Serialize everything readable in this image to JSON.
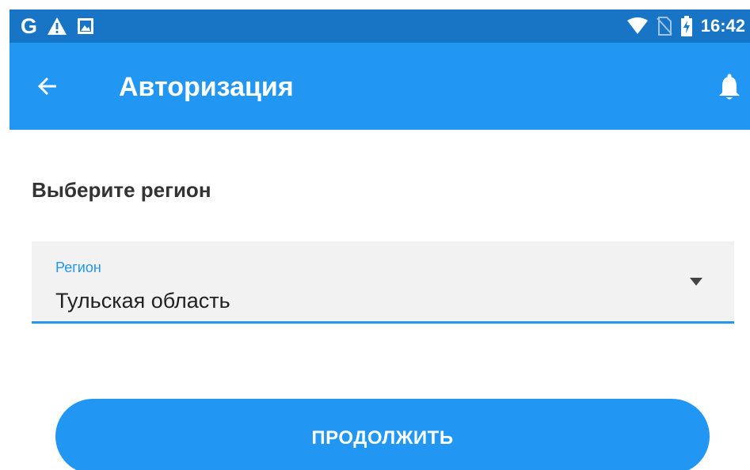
{
  "status_bar": {
    "time": "16:42",
    "left_icons": [
      "google-icon",
      "warning-icon",
      "image-notification-icon"
    ],
    "right_icons": [
      "wifi-icon",
      "no-sim-icon",
      "battery-charging-icon"
    ],
    "google_glyph": "G"
  },
  "app_bar": {
    "title": "Авторизация",
    "back_icon": "arrow-back-icon",
    "action_icon": "bell-icon",
    "color": "#2196f3"
  },
  "content": {
    "heading": "Выберите регион",
    "region_field": {
      "label": "Регион",
      "value": "Тульская область",
      "accent": "#2196f3"
    },
    "continue_button": {
      "label": "ПРОДОЛЖИТЬ"
    }
  }
}
